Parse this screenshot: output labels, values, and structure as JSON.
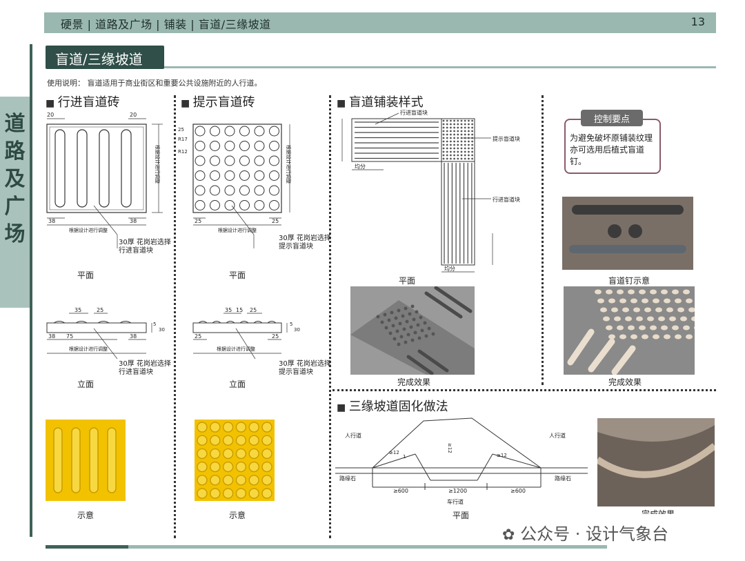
{
  "header": {
    "crumbs": "硬景 | 道路及广场 | 铺装 | 盲道/三缘坡道",
    "page_number": "13"
  },
  "side_tab": {
    "title": "道路及广场"
  },
  "section": {
    "title": "盲道/三缘坡道",
    "usage_note": "使用说明： 盲道适用于商业街区和重要公共设施附近的人行道。"
  },
  "col1": {
    "heading": "行进盲道砖",
    "plan_dims": {
      "top_left": "20",
      "top_right": "20",
      "bot_left": "38",
      "bot_right": "38",
      "side_label": "根据设计进行调整",
      "bottom_label": "根据设计进行调整"
    },
    "plan_note_1": "30厚  花岗岩选择",
    "plan_note_2": "行进盲道块",
    "plan_caption": "平面",
    "elev_dims": {
      "a": "35",
      "b": "25",
      "c": "38",
      "d": "75",
      "e": "38",
      "h1": "5",
      "h2": "30",
      "label": "根据设计进行调整"
    },
    "elev_note_1": "30厚  花岗岩选择",
    "elev_note_2": "行进盲道块",
    "elev_caption": "立面",
    "sample_caption": "示意"
  },
  "col2": {
    "heading": "提示盲道砖",
    "plan_dims": {
      "a": "25",
      "r1": "R17",
      "r2": "R12",
      "bot_left": "25",
      "bot_right": "25",
      "side_label": "根据设计进行调整",
      "bottom_label": "根据设计进行调整"
    },
    "plan_note_1": "30厚  花岗岩选择",
    "plan_note_2": "提示盲道块",
    "plan_caption": "平面",
    "elev_dims": {
      "a": "35",
      "b": "15",
      "c": "25",
      "d": "25",
      "e": "25",
      "h1": "5",
      "h2": "30",
      "label": "根据设计进行调整"
    },
    "elev_note_1": "30厚  花岗岩选择",
    "elev_note_2": "提示盲道块",
    "elev_caption": "立面",
    "sample_caption": "示意"
  },
  "col3": {
    "heading": "盲道铺装样式",
    "label_forward_1": "行进盲道块",
    "label_warning": "提示盲道块",
    "label_forward_2": "行进盲道块",
    "dim_even": "均分",
    "plan_caption": "平面",
    "photo_caption": "完成效果"
  },
  "col4": {
    "notes_title": "控制要点",
    "notes_body": "为避免破坏原铺装纹理亦可选用后植式盲道钉。",
    "stud_caption": "盲道钉示意",
    "photo_caption": "完成效果"
  },
  "ramp": {
    "heading": "三缘坡道固化做法",
    "sidewalk_left": "人行道",
    "sidewalk_right": "人行道",
    "curb_left": "路缘石",
    "curb_right": "路缘石",
    "slope_1": "≥12",
    "slope_1b": "1",
    "slope_2": "≥12",
    "slope_3": "≥12",
    "dim_1": "≥600",
    "dim_2": "≥1200",
    "dim_3": "≥600",
    "lane": "车行道",
    "plan_caption": "平面",
    "photo_caption": "完成效果"
  },
  "watermark": "公众号 · 设计气象台",
  "colors": {
    "header": "#9ab8b0",
    "dark_green": "#2f4f48",
    "tile_yellow": "#f2c200",
    "note_border": "#8a5a6a"
  }
}
